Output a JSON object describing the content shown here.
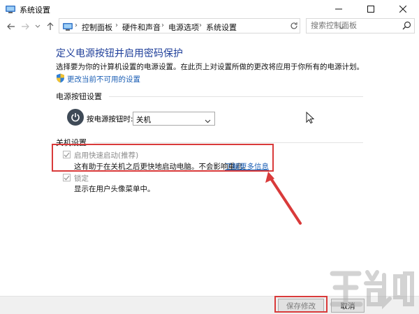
{
  "window": {
    "title": "系统设置",
    "minimize_icon": "minimize-icon",
    "maximize_icon": "maximize-icon",
    "close_icon": "close-icon"
  },
  "address": {
    "breadcrumbs": [
      "控制面板",
      "硬件和声音",
      "电源选项",
      "系统设置"
    ],
    "search_placeholder": "搜索控制面板"
  },
  "main": {
    "title": "定义电源按钮并启用密码保护",
    "intro": "选择要为你的计算机设置的电源设置。在此页上对设置所做的更改将应用于你所有的电源计划。",
    "change_link": "更改当前不可用的设置"
  },
  "power_button": {
    "group_label": "电源按钮设置",
    "label": "按电源按钮时:",
    "value": "关机"
  },
  "shutdown": {
    "group_label": "关机设置",
    "fast_startup_label": "启用快速启动(推荐)",
    "fast_startup_desc": "这有助于在关机之后更快地启动电脑。不会影响重启。",
    "learn_more": "了解更多信息",
    "lock_label": "锁定",
    "lock_desc": "显示在用户头像菜单中。"
  },
  "buttons": {
    "save": "保存修改",
    "cancel": "取消"
  },
  "colors": {
    "title_blue": "#1f3f9a",
    "link_blue": "#1c5fb5",
    "annotation_red": "#d93a3a"
  }
}
